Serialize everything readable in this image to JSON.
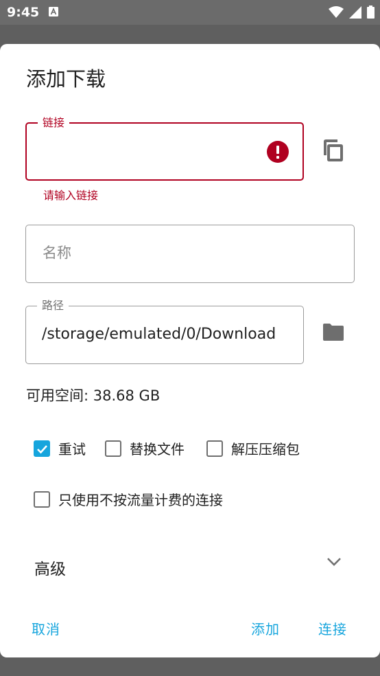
{
  "status_bar": {
    "time": "9:45",
    "icons": [
      "notification-a-icon",
      "wifi-icon",
      "cellular-icon",
      "battery-icon"
    ]
  },
  "dialog": {
    "title": "添加下载",
    "link_field": {
      "label": "链接",
      "value": "",
      "error": "请输入链接",
      "error_icon": "error-icon",
      "side_icon": "copy-icon"
    },
    "name_field": {
      "placeholder": "名称",
      "value": ""
    },
    "path_field": {
      "label": "路径",
      "value": "/storage/emulated/0/Download",
      "side_icon": "folder-icon"
    },
    "available_space": "可用空间: 38.68 GB",
    "options": {
      "retry": {
        "label": "重试",
        "checked": true
      },
      "replace_file": {
        "label": "替换文件",
        "checked": false
      },
      "unzip": {
        "label": "解压压缩包",
        "checked": false
      },
      "unmetered_only": {
        "label": "只使用不按流量计费的连接",
        "checked": false
      }
    },
    "advanced": {
      "label": "高级",
      "icon": "chevron-down-icon"
    },
    "buttons": {
      "cancel": "取消",
      "add": "添加",
      "connect": "连接"
    }
  },
  "colors": {
    "accent": "#16a5dd",
    "error": "#b00020",
    "scrim": "#5f5f5f"
  }
}
